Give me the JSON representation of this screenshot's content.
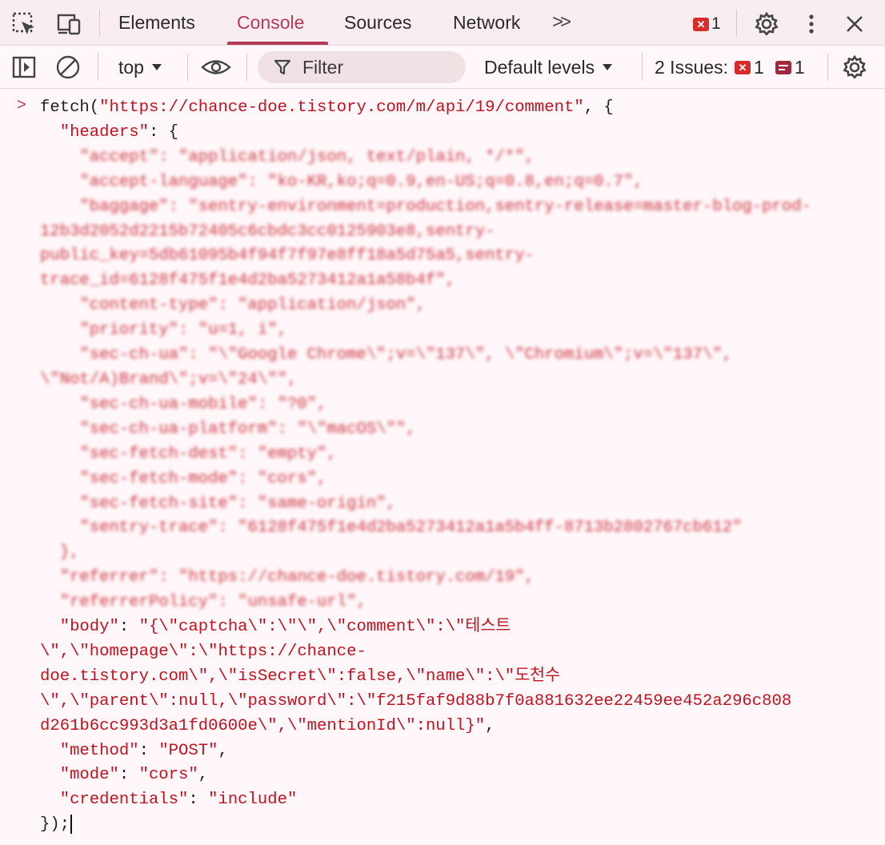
{
  "tabs": {
    "elements": "Elements",
    "console": "Console",
    "sources": "Sources",
    "network": "Network",
    "more": ">>"
  },
  "error_count": "1",
  "toolbar": {
    "context": "top",
    "filter_placeholder": "Filter",
    "levels": "Default levels",
    "issues_label": "2 Issues:",
    "issues_errors": "1",
    "issues_messages": "1"
  },
  "console": {
    "prompt": ">",
    "line_fetch_a": "fetch(",
    "url": "\"https://chance-doe.tistory.com/m/api/19/comment\"",
    "line_fetch_b": ", {",
    "headers_key": "\"headers\"",
    "headers_open": ": {",
    "blur_1": "\"accept\": \"application/json, text/plain, */*\",",
    "blur_2": "\"accept-language\": \"ko-KR,ko;q=0.9,en-US;q=0.8,en;q=0.7\",",
    "blur_3": "\"baggage\": \"sentry-environment=production,sentry-release=master-blog-prod-",
    "blur_4": "12b3d2052d2215b72405c6cbdc3cc0125903e8,sentry-",
    "blur_5": "public_key=5db61095b4f94f7f97e8ff18a5d75a5,sentry-",
    "blur_6": "trace_id=6128f475f1e4d2ba5273412a1a58b4f\",",
    "blur_7": "\"content-type\": \"application/json\",",
    "blur_8": "\"priority\": \"u=1, i\",",
    "blur_9": "\"sec-ch-ua\": \"\\\"Google Chrome\\\";v=\\\"137\\\", \\\"Chromium\\\";v=\\\"137\\\",",
    "blur_10": "\\\"Not/A)Brand\\\";v=\\\"24\\\"\",",
    "blur_11": "\"sec-ch-ua-mobile\": \"?0\",",
    "blur_12": "\"sec-ch-ua-platform\": \"\\\"macOS\\\"\",",
    "blur_13": "\"sec-fetch-dest\": \"empty\",",
    "blur_14": "\"sec-fetch-mode\": \"cors\",",
    "blur_15": "\"sec-fetch-site\": \"same-origin\",",
    "blur_16": "\"sentry-trace\": \"6128f475f1e4d2ba5273412a1a5b4ff-8713b2802767cb612\"",
    "blur_17": "},",
    "blur_18": "\"referrer\": \"https://chance-doe.tistory.com/19\",",
    "blur_19": "\"referrerPolicy\": \"unsafe-url\",",
    "body_key": "\"body\"",
    "body_1": "\"{\\\"captcha\\\":\\\"\\\",\\\"comment\\\":\\\"테스트",
    "body_2": "\\\",\\\"homepage\\\":\\\"https://chance-",
    "body_3": "doe.tistory.com\\\",\\\"isSecret\\\":false,\\\"name\\\":\\\"도천수",
    "body_4": "\\\",\\\"parent\\\":null,\\\"password\\\":\\\"f215faf9d88b7f0a881632ee22459ee452a296c808",
    "body_5": "d261b6cc993d3a1fd0600e\\\",\\\"mentionId\\\":null}\"",
    "method_key": "\"method\"",
    "method_val": "\"POST\"",
    "mode_key": "\"mode\"",
    "mode_val": "\"cors\"",
    "cred_key": "\"credentials\"",
    "cred_val": "\"include\"",
    "close": "});"
  }
}
